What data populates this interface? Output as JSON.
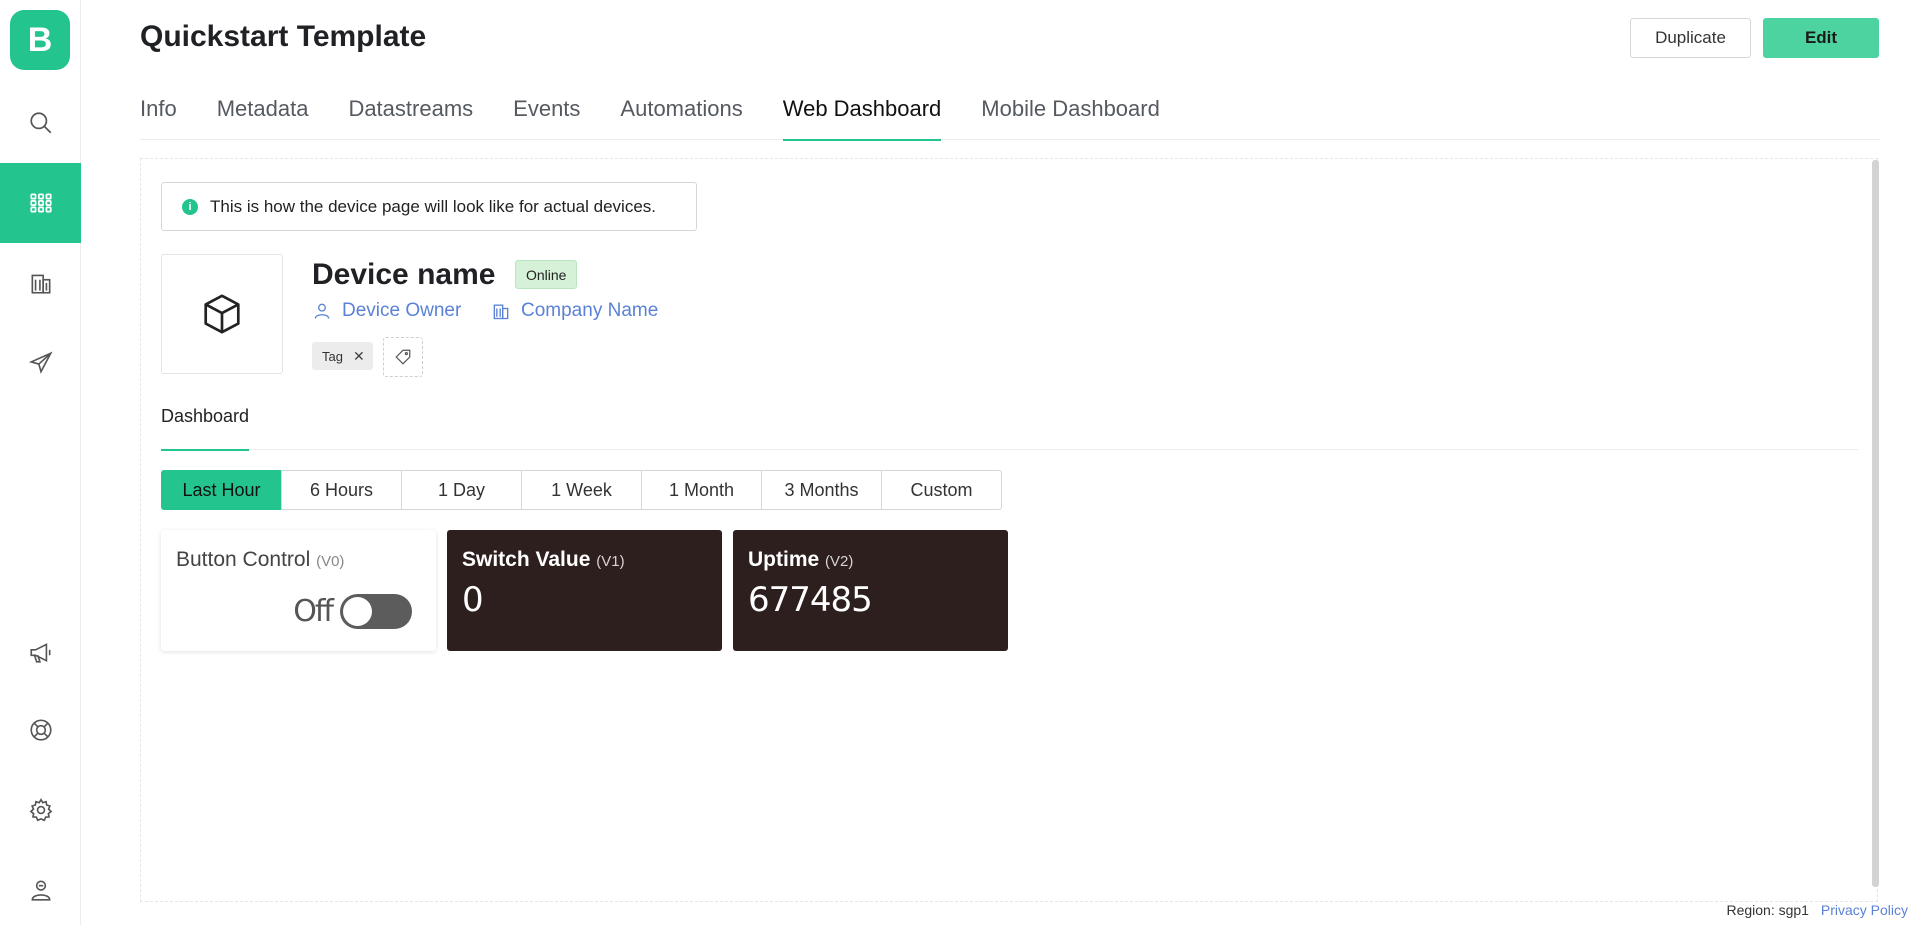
{
  "app": {
    "logo_letter": "B",
    "brand_color": "#23c48e"
  },
  "sidebar": {
    "items": [
      {
        "icon": "search-icon"
      },
      {
        "icon": "grid-icon",
        "active": true
      },
      {
        "icon": "building-icon"
      },
      {
        "icon": "send-icon"
      },
      {
        "icon": "megaphone-icon"
      },
      {
        "icon": "lifebuoy-icon"
      },
      {
        "icon": "gear-icon"
      },
      {
        "icon": "user-badge-icon"
      }
    ]
  },
  "header": {
    "title": "Quickstart Template",
    "duplicate_label": "Duplicate",
    "edit_label": "Edit"
  },
  "tabs": [
    {
      "label": "Info"
    },
    {
      "label": "Metadata"
    },
    {
      "label": "Datastreams"
    },
    {
      "label": "Events"
    },
    {
      "label": "Automations"
    },
    {
      "label": "Web Dashboard",
      "active": true
    },
    {
      "label": "Mobile Dashboard"
    }
  ],
  "banner": {
    "text": "This is how the device page will look like for actual devices."
  },
  "device": {
    "name": "Device name",
    "status": "Online",
    "owner": "Device Owner",
    "company": "Company Name",
    "tag": "Tag"
  },
  "sub_tabs": [
    {
      "label": "Dashboard",
      "active": true
    }
  ],
  "time_ranges": [
    {
      "label": "Last Hour",
      "active": true
    },
    {
      "label": "6 Hours"
    },
    {
      "label": "1 Day"
    },
    {
      "label": "1 Week"
    },
    {
      "label": "1 Month"
    },
    {
      "label": "3 Months"
    },
    {
      "label": "Custom"
    }
  ],
  "widgets": {
    "button_control": {
      "title": "Button Control",
      "pin": "(V0)",
      "state": "Off"
    },
    "switch_value": {
      "title": "Switch Value",
      "pin": "(V1)",
      "value": "0"
    },
    "uptime": {
      "title": "Uptime",
      "pin": "(V2)",
      "value": "677485"
    }
  },
  "footer": {
    "region": "Region: sgp1",
    "privacy": "Privacy Policy"
  }
}
